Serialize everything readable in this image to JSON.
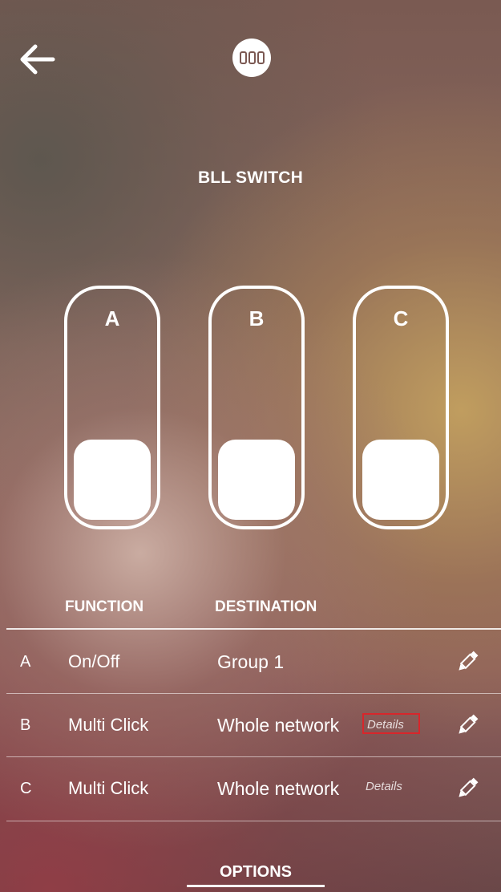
{
  "header": {
    "back_icon": "arrow-left-icon",
    "logo_icon": "switch-device-icon",
    "title": "BLL SWITCH"
  },
  "switches": [
    {
      "label": "A",
      "state": "off"
    },
    {
      "label": "B",
      "state": "off"
    },
    {
      "label": "C",
      "state": "off"
    }
  ],
  "table": {
    "columns": {
      "function": "FUNCTION",
      "destination": "DESTINATION"
    },
    "rows": [
      {
        "letter": "A",
        "function": "On/Off",
        "destination": "Group 1",
        "details": ""
      },
      {
        "letter": "B",
        "function": "Multi Click",
        "destination": "Whole network",
        "details": "Details"
      },
      {
        "letter": "C",
        "function": "Multi Click",
        "destination": "Whole network",
        "details": "Details"
      }
    ]
  },
  "footer": {
    "options_label": "OPTIONS"
  },
  "colors": {
    "text": "#ffffff",
    "highlight_box": "#d8262b"
  }
}
